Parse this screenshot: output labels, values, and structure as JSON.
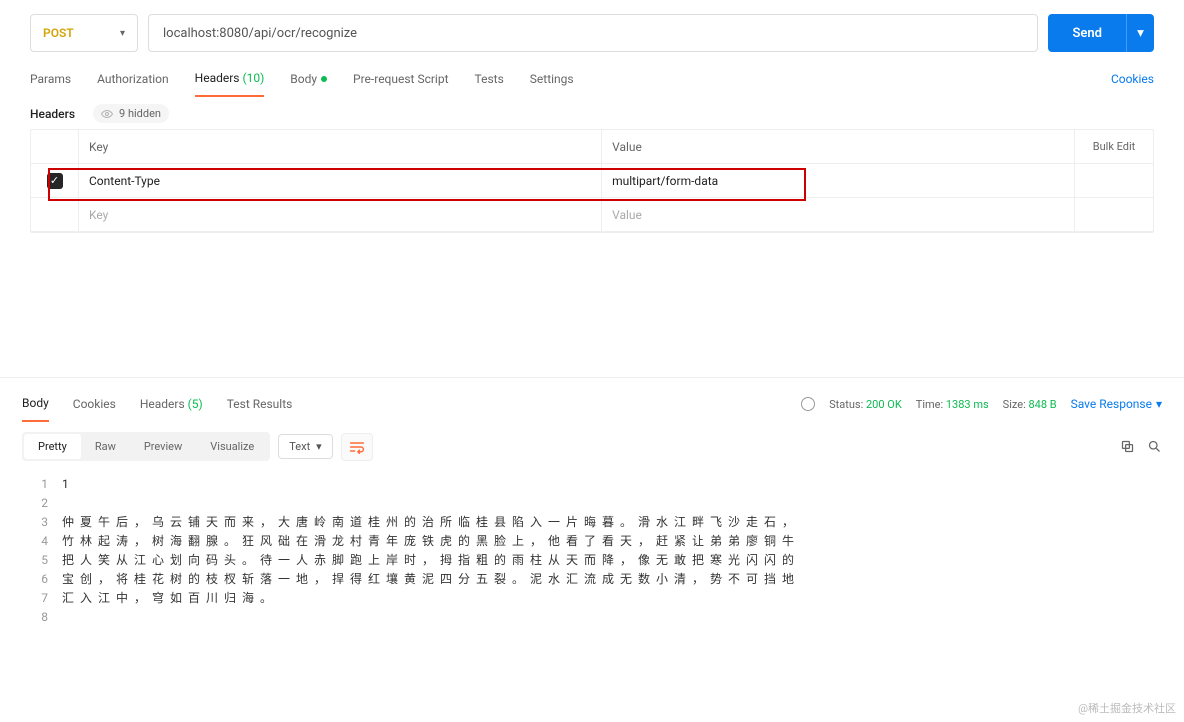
{
  "request": {
    "method": "POST",
    "url": "localhost:8080/api/ocr/recognize",
    "send": "Send"
  },
  "tabs": {
    "params": "Params",
    "authorization": "Authorization",
    "headers_label": "Headers",
    "headers_count": "(10)",
    "body": "Body",
    "prerequest": "Pre-request Script",
    "tests": "Tests",
    "settings": "Settings",
    "cookies": "Cookies"
  },
  "headers": {
    "title": "Headers",
    "hidden": "9 hidden",
    "col_key": "Key",
    "col_value": "Value",
    "bulk_edit": "Bulk Edit",
    "rows": [
      {
        "checked": true,
        "key": "Content-Type",
        "value": "multipart/form-data"
      }
    ],
    "placeholder_key": "Key",
    "placeholder_value": "Value"
  },
  "response": {
    "tab_body": "Body",
    "tab_cookies": "Cookies",
    "tab_headers": "Headers",
    "tab_headers_count": "(5)",
    "tab_results": "Test Results",
    "status_label": "Status:",
    "status_value": "200 OK",
    "time_label": "Time:",
    "time_value": "1383 ms",
    "size_label": "Size:",
    "size_value": "848 B",
    "save": "Save Response",
    "views": {
      "pretty": "Pretty",
      "raw": "Raw",
      "preview": "Preview",
      "visualize": "Visualize"
    },
    "lang": "Text"
  },
  "body_lines": {
    "l1": "1",
    "l2": "",
    "l3": "仲夏午后，乌云铺天而来，大唐岭南道桂州的治所临桂县陷入一片晦暮。滑水江畔飞沙走石，",
    "l4": "竹林起涛，树海翻腺。狂风础在滑龙村青年庞铁虎的黑脸上，他看了看天，赶紧让弟弟廖铜牛",
    "l5": "把人笑从江心划向码头。待一人赤脚跑上岸时，拇指粗的雨柱从天而降，像无敢把寒光闪闪的",
    "l6": "宝创，将桂花树的枝杈斩落一地，捍得红壤黄泥四分五裂。泥水汇流成无数小清，势不可挡地",
    "l7": "汇入江中，穹如百川归海。",
    "l8": ""
  },
  "watermark": "@稀土掘金技术社区"
}
